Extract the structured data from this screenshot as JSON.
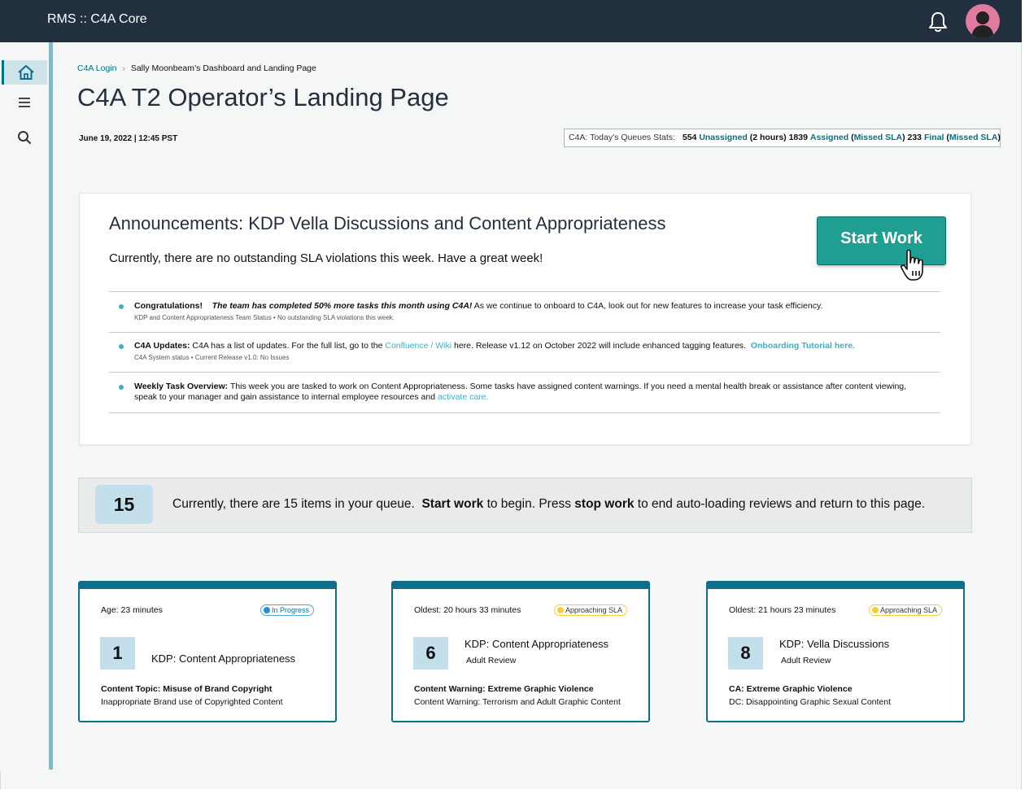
{
  "app": {
    "title": "RMS :: C4A Core"
  },
  "sidebar": {
    "items": [
      "home-icon",
      "menu-icon",
      "search-icon"
    ]
  },
  "breadcrumb": {
    "link": "C4A Login",
    "current": "Sally Moonbeam’s Dashboard and Landing Page"
  },
  "page": {
    "title": "C4A T2 Operator’s Landing Page",
    "datetime": "June  19, 2022 | 12:45 PST"
  },
  "stats": {
    "label": "C4A: Today’s Queues Stats:",
    "unassigned_count": "554",
    "unassigned_label": "Unassigned",
    "unassigned_note": "(2 hours)",
    "assigned_count": "1839",
    "assigned_label": "Assigned",
    "missed_sla": "Missed SLA",
    "final_count": "233",
    "final_label": "Final"
  },
  "announcement": {
    "title": "Announcements: KDP Vella Discussions and Content Appropriateness",
    "subtitle": "Currently, there are no outstanding SLA violations this week. Have a great week!",
    "start_button": "Start Work",
    "items": [
      {
        "label": "Congratulations!",
        "emphasis": "The team has completed 50% more tasks this month using C4A!",
        "text": "As we continue to onboard to C4A, look out for new features to increase your task efficiency.",
        "meta": "KDP and Content Appropriateness Team Status  •  No outstanding SLA violations this week."
      },
      {
        "label": "C4A Updates:",
        "text_a": "C4A has a list of updates.  For the full list, go to the",
        "link": "Confluence / Wiki",
        "text_b": "here.  Release v1.12 on October 2022  will include enhanced tagging features.",
        "link2": "Onboarding Tutorial here.",
        "meta": "C4A System status  •  Current Release v1.0:  No Issues"
      },
      {
        "label": "Weekly Task Overview:",
        "text_a": "This week you are tasked to work on Content Appropriateness. Some tasks have assigned content warnings.  If you need a mental health break or assistance after content viewing,",
        "text_b": "speak to your manager and gain assistance to internal employee resources and",
        "link": "activate care."
      }
    ]
  },
  "queue": {
    "count": "15",
    "text_a": "Currently, there are 15 items in your queue.",
    "start_bold": "Start work",
    "text_b": "to begin.  Press",
    "stop_bold": "stop work",
    "text_c": "to end auto-loading reviews and return to this page."
  },
  "cards": [
    {
      "age": "Age: 23 minutes",
      "badge": "In Progress",
      "number": "1",
      "title": "KDP: Content Appropriateness",
      "subtitle": "",
      "topic": "Content Topic: Misuse of Brand Copyright",
      "desc": "Inappropriate Brand use of Copyrighted Content"
    },
    {
      "age": "Oldest: 20 hours 33 minutes",
      "badge": "Approaching SLA",
      "number": "6",
      "title": "KDP: Content Appropriateness",
      "subtitle": "Adult Review",
      "topic": "Content Warning: Extreme Graphic Violence",
      "desc": "Content Warning: Terrorism and Adult Graphic Content"
    },
    {
      "age": "Oldest: 21 hours 23 minutes",
      "badge": "Approaching SLA",
      "number": "8",
      "title": "KDP: Vella Discussions",
      "subtitle": "Adult Review",
      "topic": "CA: Extreme Graphic Violence",
      "desc": "DC: Disappointing Graphic Sexual Content"
    }
  ],
  "colors": {
    "topbar": "#222f3e",
    "accent": "#1f9e92",
    "link": "#007185",
    "card_border": "#0f6e8c"
  }
}
